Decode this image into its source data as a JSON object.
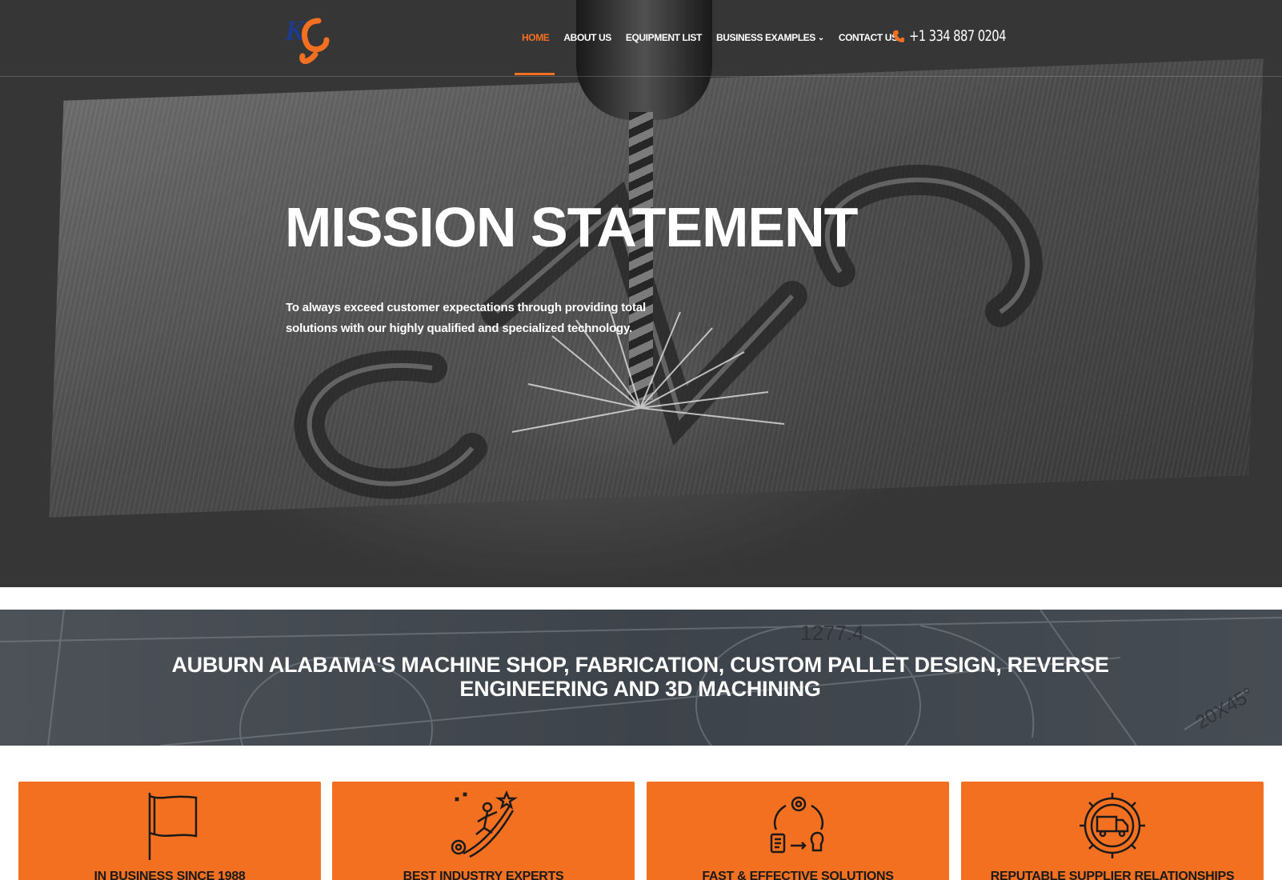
{
  "nav": {
    "items": [
      {
        "label": "HOME",
        "active": true
      },
      {
        "label": "ABOUT US"
      },
      {
        "label": "EQUIPMENT LIST"
      },
      {
        "label": "BUSINESS EXAMPLES",
        "has_dropdown": true
      },
      {
        "label": "CONTACT US"
      }
    ],
    "phone": "+1 334 887 0204",
    "logo_icon": "kc-logo"
  },
  "hero": {
    "title": "MISSION STATEMENT",
    "text": "To always exceed customer expectations through providing total solutions with our highly qualified and specialized technology."
  },
  "banner": {
    "title": "AUBURN ALABAMA'S MACHINE SHOP, FABRICATION, CUSTOM PALLET DESIGN, REVERSE ENGINEERING AND 3D MACHINING",
    "drawing_text_1": "1277.4",
    "drawing_text_2": "20X45°"
  },
  "features": [
    {
      "label": "IN BUSINESS SINCE 1988",
      "icon": "flag-icon"
    },
    {
      "label": "BEST INDUSTRY EXPERTS",
      "icon": "climber-icon"
    },
    {
      "label": "FAST & EFFECTIVE SOLUTIONS",
      "icon": "cycle-icon"
    },
    {
      "label": "REPUTABLE SUPPLIER RELATIONSHIPS",
      "icon": "delivery-gear-icon"
    }
  ],
  "colors": {
    "accent": "#f37021",
    "banner": "#434950",
    "text_dark": "#1a1a1a"
  }
}
